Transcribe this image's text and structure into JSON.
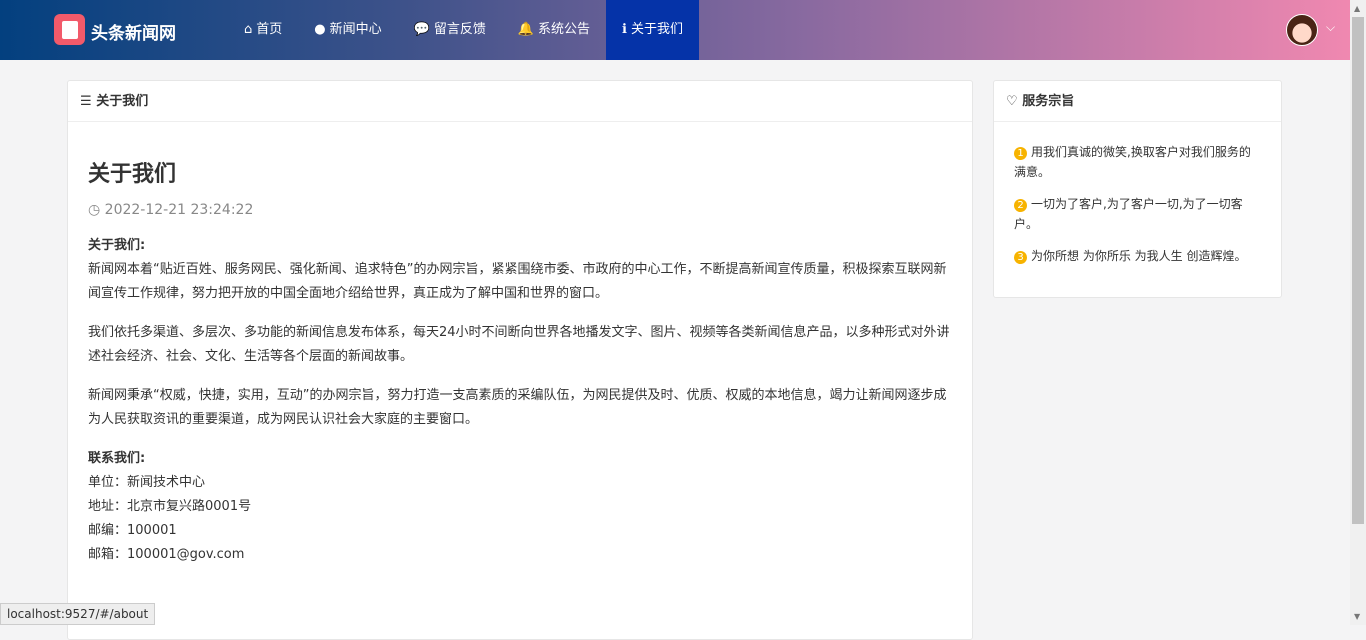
{
  "nav": {
    "brand": "头条新闻网",
    "items": [
      {
        "icon": "home-icon",
        "glyph": "⌂",
        "label": "首页"
      },
      {
        "icon": "globe-icon",
        "glyph": "●",
        "label": "新闻中心"
      },
      {
        "icon": "comment-icon",
        "glyph": "💬",
        "label": "留言反馈"
      },
      {
        "icon": "bell-icon",
        "glyph": "🔔",
        "label": "系统公告"
      },
      {
        "icon": "info-icon",
        "glyph": "ℹ",
        "label": "关于我们",
        "active": true
      }
    ],
    "caret": "⌵"
  },
  "main": {
    "header": "关于我们",
    "title": "关于我们",
    "date": "2022-12-21 23:24:22",
    "about_heading": "关于我们:",
    "p1": "新闻网本着“贴近百姓、服务网民、强化新闻、追求特色”的办网宗旨，紧紧围绕市委、市政府的中心工作，不断提高新闻宣传质量，积极探索互联网新闻宣传工作规律，努力把开放的中国全面地介绍给世界，真正成为了解中国和世界的窗口。",
    "p2": "我们依托多渠道、多层次、多功能的新闻信息发布体系，每天24小时不间断向世界各地播发文字、图片、视频等各类新闻信息产品，以多种形式对外讲述社会经济、社会、文化、生活等各个层面的新闻故事。",
    "p3": "新闻网秉承“权威，快捷，实用，互动”的办网宗旨，努力打造一支高素质的采编队伍，为网民提供及时、优质、权威的本地信息，竭力让新闻网逐步成为人民获取资讯的重要渠道，成为网民认识社会大家庭的主要窗口。",
    "contact_heading": "联系我们:",
    "contact": [
      "单位：新闻技术中心",
      "地址：北京市复兴路0001号",
      "邮编：100001",
      "邮箱：100001@gov.com"
    ]
  },
  "side": {
    "header": "服务宗旨",
    "items": [
      {
        "n": "1",
        "text": "用我们真诚的微笑,换取客户对我们服务的满意。"
      },
      {
        "n": "2",
        "text": "一切为了客户,为了客户一切,为了一切客户。"
      },
      {
        "n": "3",
        "text": "为你所想 为你所乐 为我人生 创造辉煌。"
      }
    ]
  },
  "status": "localhost:9527/#/about"
}
